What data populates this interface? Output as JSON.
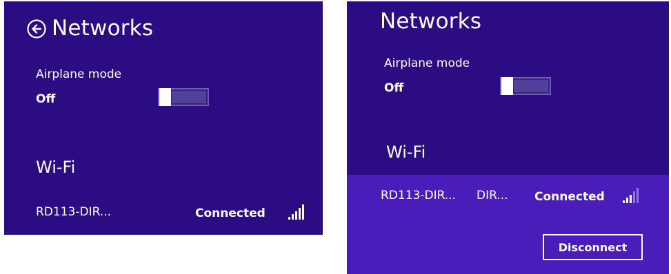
{
  "left_panel": {
    "title": "Networks",
    "airplane_mode_label": "Airplane mode",
    "airplane_mode_state": "Off",
    "airplane_mode_on": false,
    "wifi_section": "Wi-Fi",
    "network": {
      "name": "RD113-DIR...",
      "status": "Connected",
      "signal_icon": "wifi-signal-icon"
    }
  },
  "right_panel": {
    "title": "Networks",
    "airplane_mode_label": "Airplane mode",
    "airplane_mode_state": "Off",
    "airplane_mode_on": false,
    "wifi_section": "Wi-Fi",
    "network": {
      "name": "RD113-DIR...",
      "security": "DIR...",
      "status": "Connected",
      "signal_icon": "wifi-signal-icon",
      "disconnect_label": "Disconnect"
    }
  },
  "colors": {
    "panel_bg": "#2b0c82",
    "selected_row_bg": "#4a1dbb",
    "text": "#ffffff"
  }
}
